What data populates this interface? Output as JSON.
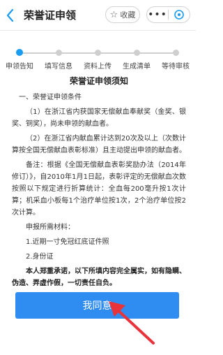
{
  "header": {
    "title": "荣誉证申领",
    "favorite_label": "收藏",
    "more_label": "•••"
  },
  "steps": [
    {
      "label": "申领告知",
      "active": true
    },
    {
      "label": "填写信息",
      "active": false
    },
    {
      "label": "资料上传",
      "active": false
    },
    {
      "label": "生成清单",
      "active": false
    },
    {
      "label": "等待审核",
      "active": false
    }
  ],
  "notice": {
    "heading": "荣誉证申领须知",
    "section1": "一、荣誉证申领条件",
    "cond1": "（1）在浙江省内获国家无偿献血奉献奖（金奖、银奖、铜奖），尚未申领的献血者。",
    "cond2": "（2）在浙江省内献血累计达到20次及以上（次数计算按全国无偿献血表彰标准）且主动提出申领的献血者。",
    "note": "备注：根据《全国无偿献血表彰奖励办法（2014年修订）》，自2010年1月1日起，表彰评定的无偿献血次数按照以下规定进行折算统计：全血每200毫升按1次计算；机采血小板每1个治疗单位按1次，2个治疗单位按2次计算。",
    "materials_title": "申报所需材料：",
    "material1": "1.近期一寸免冠红底证件照",
    "material2": "2.身份证",
    "promise": "本人郑重承诺，以下所填内容完全属实，如有隐瞒、伪造、弄虚作假，一切责任自负。"
  },
  "agree_button": "我同意",
  "colors": {
    "accent": "#2f8cf0",
    "step_active": "#1a9cf0",
    "annotation_arrow": "#e8333a"
  }
}
